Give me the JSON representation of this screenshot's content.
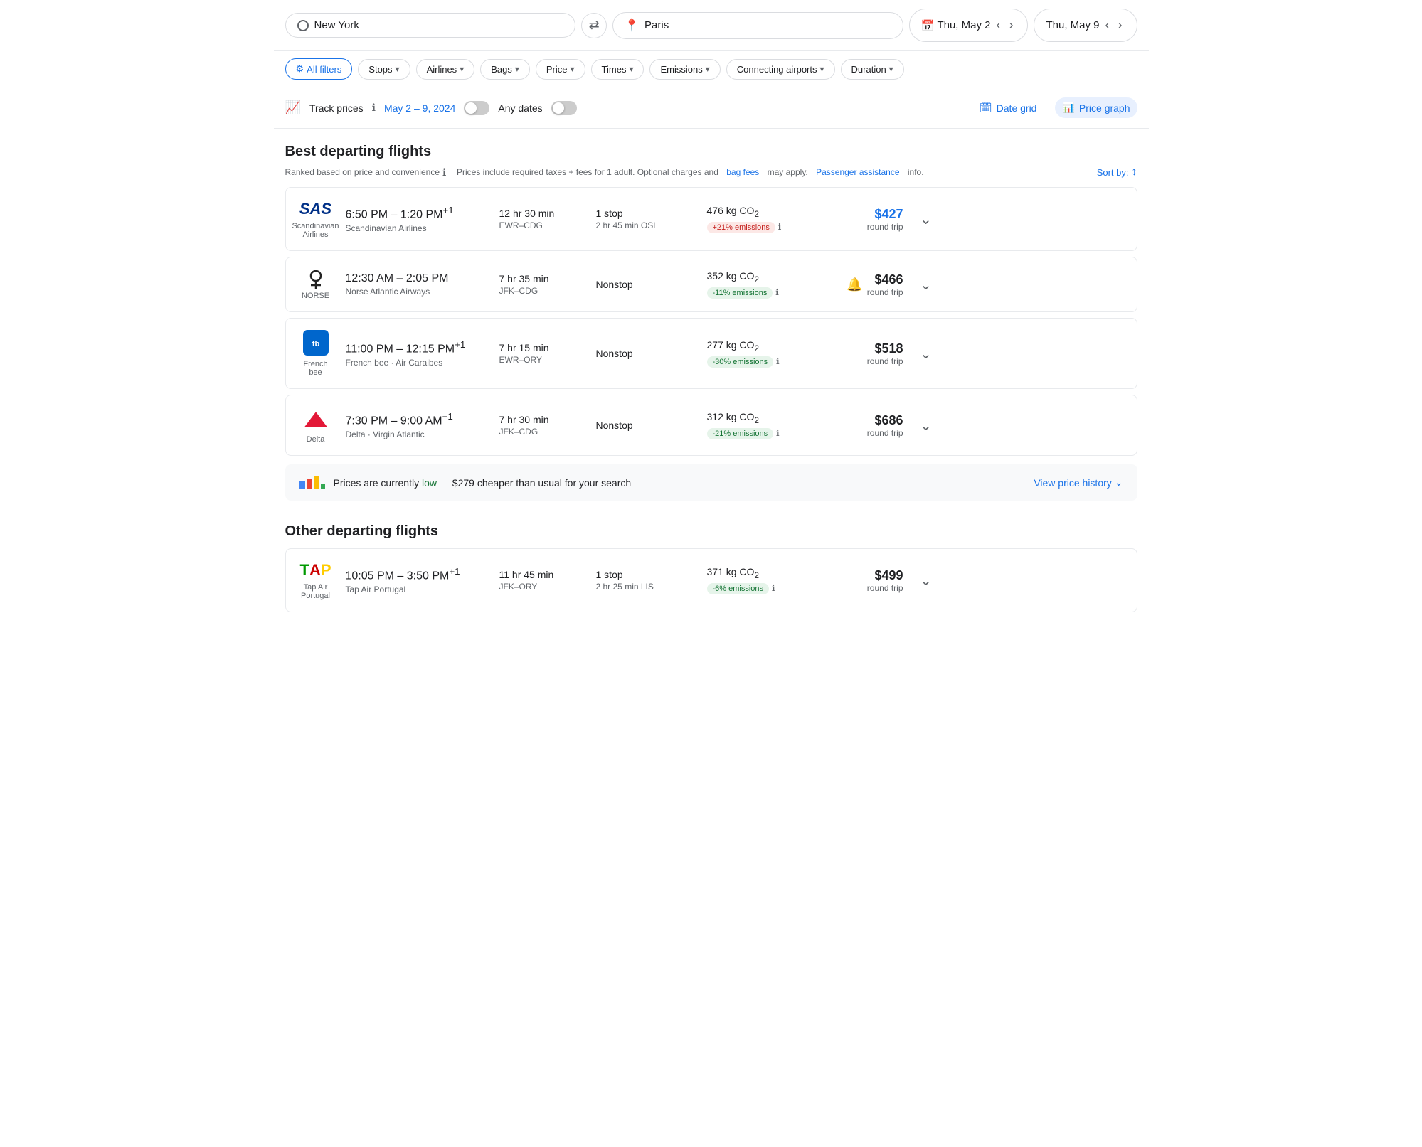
{
  "search": {
    "origin": "New York",
    "destination": "Paris",
    "origin_icon": "circle-icon",
    "dest_icon": "location-pin-icon",
    "swap_label": "⇄",
    "date_icon": "calendar-icon",
    "depart_date": "Thu, May 2",
    "return_date": "Thu, May 9"
  },
  "filters": {
    "all_filters_label": "All filters",
    "buttons": [
      {
        "label": "Stops",
        "id": "stops"
      },
      {
        "label": "Airlines",
        "id": "airlines"
      },
      {
        "label": "Bags",
        "id": "bags"
      },
      {
        "label": "Price",
        "id": "price"
      },
      {
        "label": "Times",
        "id": "times"
      },
      {
        "label": "Emissions",
        "id": "emissions"
      },
      {
        "label": "Connecting airports",
        "id": "connecting"
      },
      {
        "label": "Duration",
        "id": "duration"
      }
    ]
  },
  "track": {
    "label": "Track prices",
    "date_range": "May 2 – 9, 2024",
    "any_dates_label": "Any dates",
    "date_grid_label": "Date grid",
    "price_graph_label": "Price graph"
  },
  "best_flights": {
    "title": "Best departing flights",
    "subtitle": "Ranked based on price and convenience",
    "taxes_note": "Prices include required taxes + fees for 1 adult. Optional charges and",
    "bag_fees_link": "bag fees",
    "may_apply": "may apply.",
    "passenger_link": "Passenger assistance",
    "passenger_info": "info.",
    "sort_label": "Sort by:",
    "flights": [
      {
        "airline": "SAS",
        "airline_full": "Scandinavian Airlines",
        "depart": "6:50 PM",
        "arrive": "1:20 PM",
        "plus_days": "+1",
        "duration": "12 hr 30 min",
        "route": "EWR–CDG",
        "stops": "1 stop",
        "stop_detail": "2 hr 45 min OSL",
        "emissions_kg": "476 kg CO₂",
        "emissions_badge": "+21% emissions",
        "badge_type": "red",
        "price": "$427",
        "price_color": "blue",
        "price_sub": "round trip",
        "has_bell": false
      },
      {
        "airline": "NORSE",
        "airline_full": "Norse Atlantic Airways",
        "depart": "12:30 AM",
        "arrive": "2:05 PM",
        "plus_days": "",
        "duration": "7 hr 35 min",
        "route": "JFK–CDG",
        "stops": "Nonstop",
        "stop_detail": "",
        "emissions_kg": "352 kg CO₂",
        "emissions_badge": "-11% emissions",
        "badge_type": "green",
        "price": "$466",
        "price_color": "black",
        "price_sub": "round trip",
        "has_bell": true
      },
      {
        "airline": "FrenchBee",
        "airline_full": "French bee · Air Caraibes",
        "depart": "11:00 PM",
        "arrive": "12:15 PM",
        "plus_days": "+1",
        "duration": "7 hr 15 min",
        "route": "EWR–ORY",
        "stops": "Nonstop",
        "stop_detail": "",
        "emissions_kg": "277 kg CO₂",
        "emissions_badge": "-30% emissions",
        "badge_type": "green",
        "price": "$518",
        "price_color": "black",
        "price_sub": "round trip",
        "has_bell": false
      },
      {
        "airline": "Delta",
        "airline_full": "Delta · Virgin Atlantic",
        "depart": "7:30 PM",
        "arrive": "9:00 AM",
        "plus_days": "+1",
        "duration": "7 hr 30 min",
        "route": "JFK–CDG",
        "stops": "Nonstop",
        "stop_detail": "",
        "emissions_kg": "312 kg CO₂",
        "emissions_badge": "-21% emissions",
        "badge_type": "green",
        "price": "$686",
        "price_color": "black",
        "price_sub": "round trip",
        "has_bell": false
      }
    ]
  },
  "price_notice": {
    "text_before": "Prices are currently",
    "status": "low",
    "text_after": "— $279 cheaper than usual for your search",
    "view_history": "View price history"
  },
  "other_flights": {
    "title": "Other departing flights",
    "flights": [
      {
        "airline": "TAP",
        "airline_full": "Tap Air Portugal",
        "depart": "10:05 PM",
        "arrive": "3:50 PM",
        "plus_days": "+1",
        "duration": "11 hr 45 min",
        "route": "JFK–ORY",
        "stops": "1 stop",
        "stop_detail": "2 hr 25 min LIS",
        "emissions_kg": "371 kg CO₂",
        "emissions_badge": "-6% emissions",
        "badge_type": "green",
        "price": "$499",
        "price_color": "black",
        "price_sub": "round trip",
        "has_bell": false
      }
    ]
  }
}
